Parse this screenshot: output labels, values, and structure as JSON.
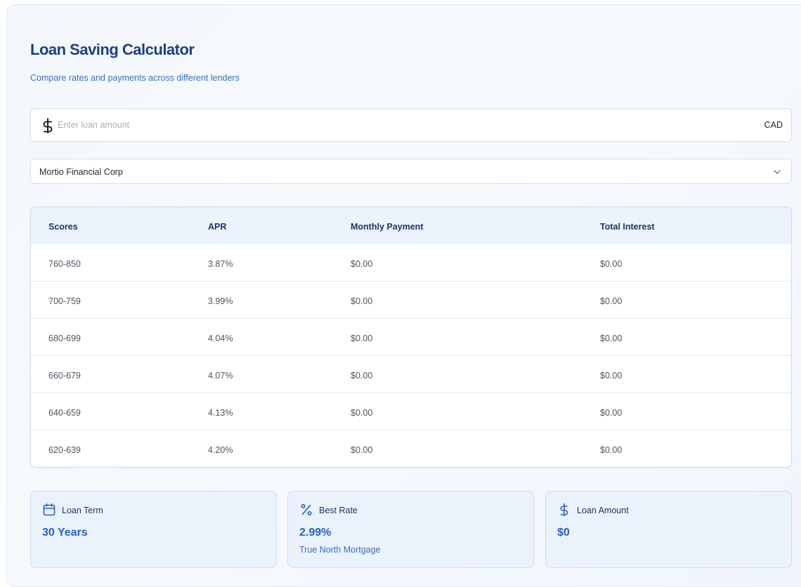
{
  "header": {
    "title": "Loan Saving Calculator",
    "subtitle": "Compare rates and payments across different lenders"
  },
  "amount_input": {
    "placeholder": "Enter loan amount",
    "value": "",
    "currency": "CAD",
    "icon": "dollar-icon"
  },
  "lender_select": {
    "selected": "Mortio Financial Corp",
    "icon": "chevron-down-icon"
  },
  "table": {
    "columns": [
      "Scores",
      "APR",
      "Monthly Payment",
      "Total Interest"
    ],
    "rows": [
      [
        "760-850",
        "3.87%",
        "$0.00",
        "$0.00"
      ],
      [
        "700-759",
        "3.99%",
        "$0.00",
        "$0.00"
      ],
      [
        "680-699",
        "4.04%",
        "$0.00",
        "$0.00"
      ],
      [
        "660-679",
        "4.07%",
        "$0.00",
        "$0.00"
      ],
      [
        "640-659",
        "4.13%",
        "$0.00",
        "$0.00"
      ],
      [
        "620-639",
        "4.20%",
        "$0.00",
        "$0.00"
      ]
    ]
  },
  "stats": [
    {
      "icon": "calendar-icon",
      "label": "Loan Term",
      "value": "30 Years",
      "sub": ""
    },
    {
      "icon": "percent-icon",
      "label": "Best Rate",
      "value": "2.99%",
      "sub": "True North Mortgage"
    },
    {
      "icon": "dollar-icon",
      "label": "Loan Amount",
      "value": "$0",
      "sub": ""
    }
  ],
  "colors": {
    "title": "#1e3f82",
    "accent": "#2860c0",
    "subtitle": "#3a6fb7",
    "table_header_bg": "#ecf3fc"
  }
}
